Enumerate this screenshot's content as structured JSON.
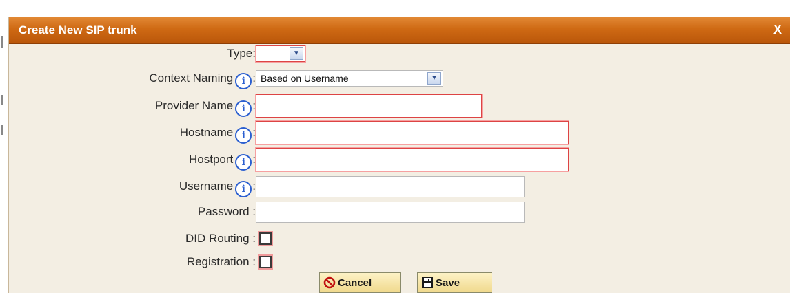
{
  "dialog": {
    "title": "Create New SIP trunk",
    "close_label": "X"
  },
  "form": {
    "type": {
      "label": "Type:",
      "value": ""
    },
    "context_naming": {
      "label": "Context Naming",
      "value": "Based on Username"
    },
    "provider_name": {
      "label": "Provider Name",
      "value": ""
    },
    "hostname": {
      "label": "Hostname",
      "value": ""
    },
    "hostport": {
      "label": "Hostport",
      "value": ""
    },
    "username": {
      "label": "Username",
      "value": ""
    },
    "password": {
      "label": "Password :",
      "value": ""
    },
    "did_routing": {
      "label": "DID Routing :",
      "checked": false
    },
    "registration": {
      "label": "Registration :",
      "checked": false
    }
  },
  "buttons": {
    "cancel_label": "Cancel",
    "save_label": "Save"
  },
  "colors": {
    "titlebar": "#cf6a14",
    "dialog_bg": "#f3eee3",
    "required_border": "#d44",
    "info_icon": "#2b5fd0",
    "button_bg": "#f0d98d"
  },
  "icons": {
    "info": "info-icon",
    "cancel": "no-entry-icon",
    "save": "floppy-disk-icon",
    "dropdown": "chevron-down-icon"
  }
}
